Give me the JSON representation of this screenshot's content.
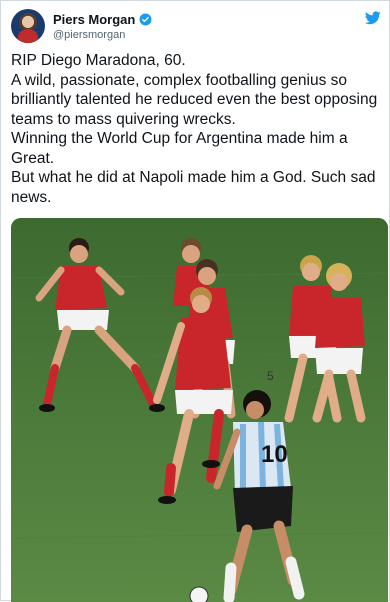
{
  "author": {
    "name": "Piers Morgan",
    "handle": "@piersmorgan",
    "verified": true,
    "avatar_icon": "profile-avatar"
  },
  "tweet": {
    "lines": [
      "RIP Diego Maradona, 60.",
      "A wild, passionate, complex footballing genius so",
      "brilliantly talented he reduced even the best opposing",
      "teams to mass quivering wrecks.",
      "Winning the World Cup for Argentina made him a",
      "Great.",
      "But what he did at Napoli made him a God. Such sad",
      "news."
    ]
  },
  "media": {
    "jersey_numbers": [
      "10",
      "5",
      "10"
    ]
  },
  "colors": {
    "verified_blue": "#1d9bf0",
    "twitter_blue": "#1d9bf0",
    "text": "#0f1419",
    "secondary": "#536471"
  }
}
